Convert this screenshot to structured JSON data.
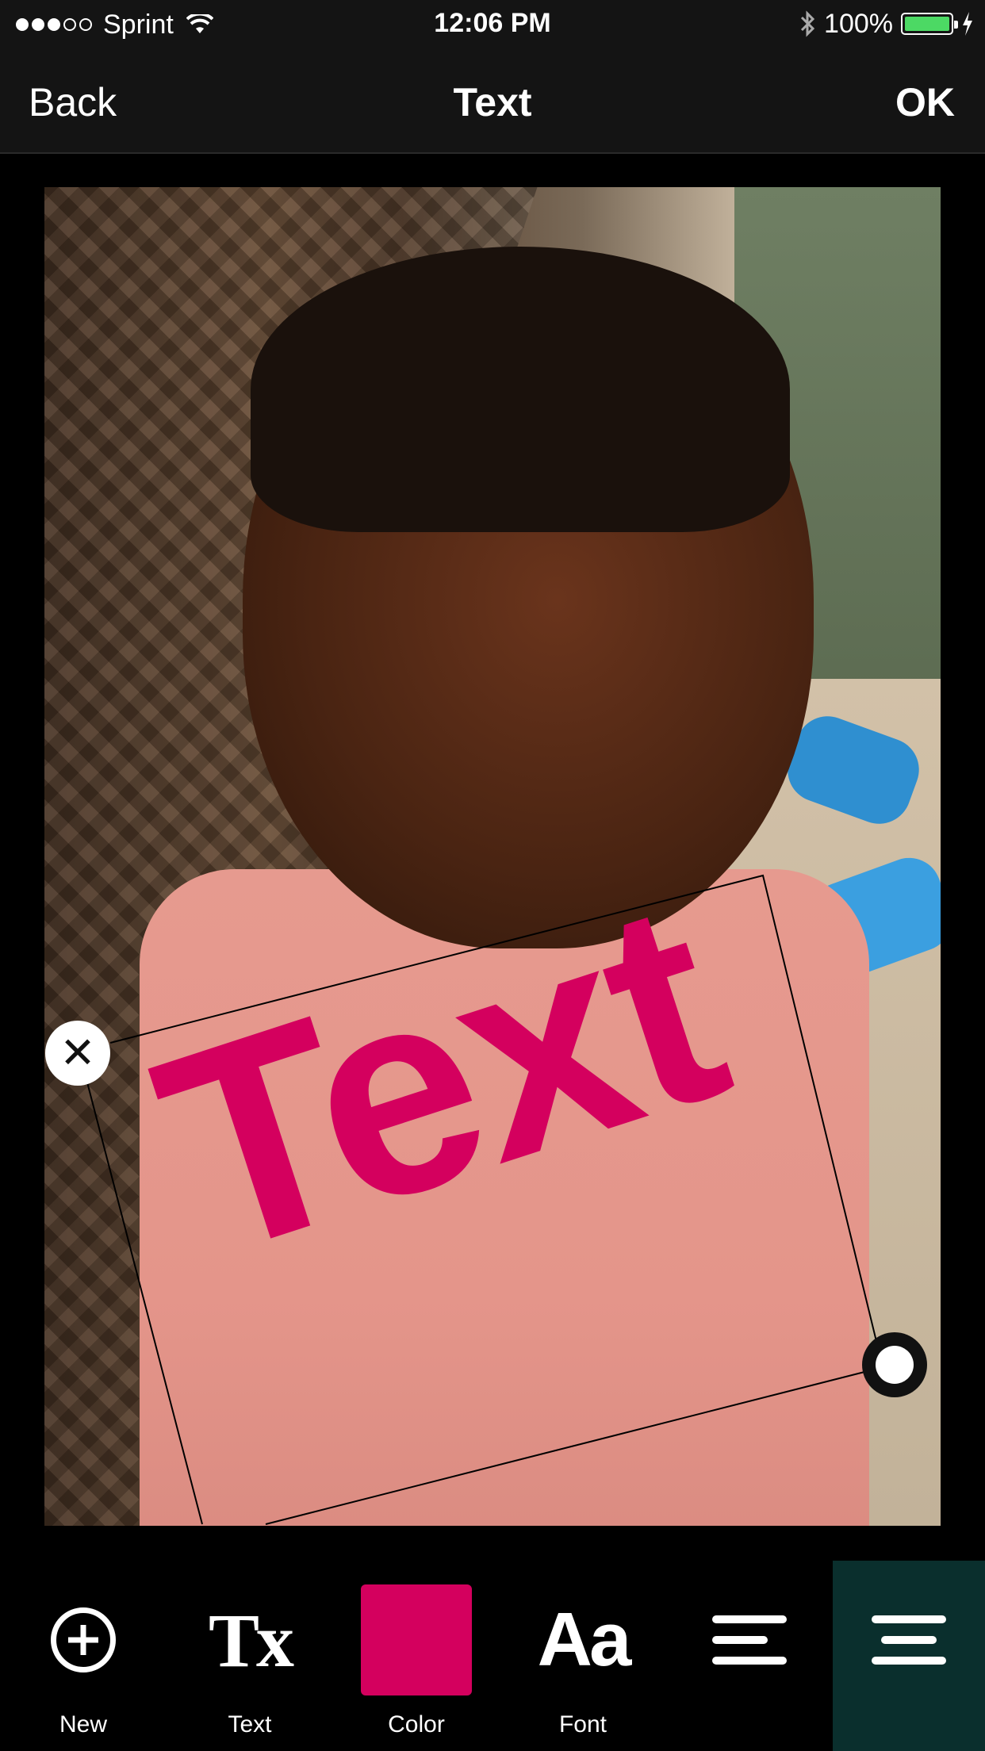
{
  "status_bar": {
    "carrier": "Sprint",
    "time": "12:06 PM",
    "battery": "100%",
    "signal_bars_filled": 3,
    "signal_bars_total": 5
  },
  "nav": {
    "back_label": "Back",
    "title": "Text",
    "ok_label": "OK"
  },
  "canvas": {
    "overlay_text": "Text",
    "overlay_color": "#d4005e"
  },
  "toolbar": {
    "items": [
      {
        "label": "New",
        "icon": "plus-circle-icon"
      },
      {
        "label": "Text",
        "icon_text": "Tx",
        "icon": "text-style-icon"
      },
      {
        "label": "Color",
        "icon": "color-swatch-icon"
      },
      {
        "label": "Font",
        "icon_text": "Aa",
        "icon": "font-icon"
      },
      {
        "label": "",
        "icon": "align-left-icon"
      },
      {
        "label": "",
        "icon": "align-center-icon",
        "selected": true
      }
    ],
    "accent": "#0a2f2d"
  }
}
